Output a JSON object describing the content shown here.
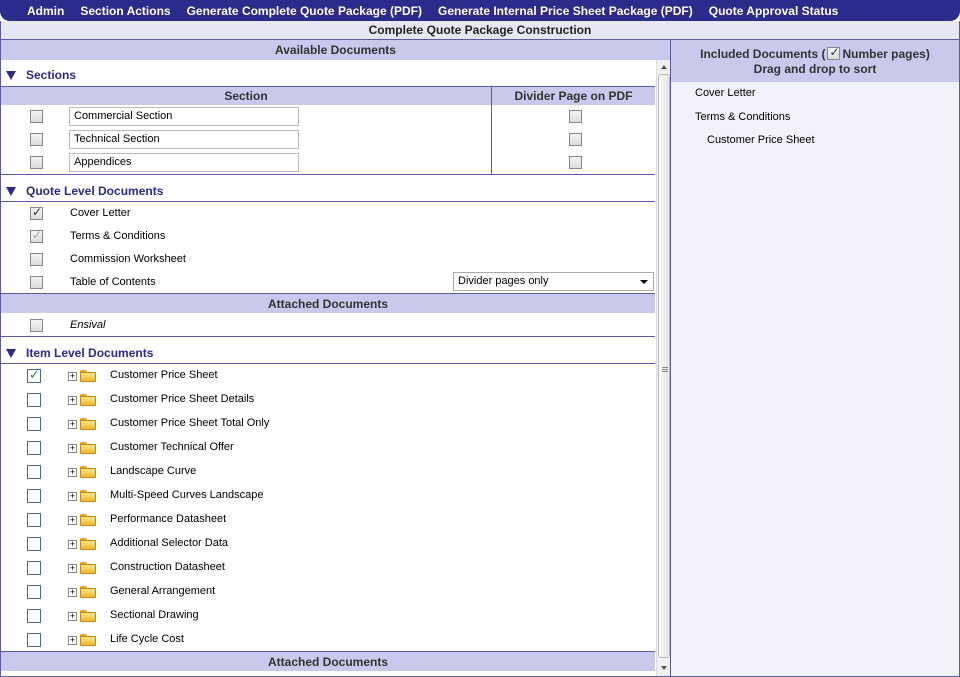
{
  "menu": [
    "Admin",
    "Section Actions",
    "Generate Complete Quote Package (PDF)",
    "Generate Internal Price Sheet Package (PDF)",
    "Quote Approval Status"
  ],
  "title": "Complete Quote Package Construction",
  "available": {
    "header": "Available Documents",
    "sections": {
      "title": "Sections",
      "col_section": "Section",
      "col_divider": "Divider Page on PDF",
      "rows": [
        {
          "name": "Commercial Section",
          "checked": false,
          "divider": false
        },
        {
          "name": "Technical Section",
          "checked": false,
          "divider": false
        },
        {
          "name": "Appendices",
          "checked": false,
          "divider": false
        }
      ]
    },
    "quote_level": {
      "title": "Quote Level Documents",
      "items": [
        {
          "label": "Cover Letter",
          "checked": true,
          "disabled": false
        },
        {
          "label": "Terms & Conditions",
          "checked": true,
          "disabled": true
        },
        {
          "label": "Commission Worksheet",
          "checked": false,
          "disabled": false
        },
        {
          "label": "Table of Contents",
          "checked": false,
          "disabled": false
        }
      ],
      "toc_select": "Divider pages only"
    },
    "attached_header": "Attached Documents",
    "attached": [
      {
        "label": "Ensival",
        "checked": false
      }
    ],
    "item_level": {
      "title": "Item Level Documents",
      "items": [
        {
          "label": "Customer Price Sheet",
          "checked": true
        },
        {
          "label": "Customer Price Sheet Details",
          "checked": false
        },
        {
          "label": "Customer Price Sheet Total Only",
          "checked": false
        },
        {
          "label": "Customer Technical Offer",
          "checked": false
        },
        {
          "label": "Landscape Curve",
          "checked": false
        },
        {
          "label": "Multi-Speed Curves Landscape",
          "checked": false
        },
        {
          "label": "Performance Datasheet",
          "checked": false
        },
        {
          "label": "Additional Selector Data",
          "checked": false
        },
        {
          "label": "Construction Datasheet",
          "checked": false
        },
        {
          "label": "General Arrangement",
          "checked": false
        },
        {
          "label": "Sectional Drawing",
          "checked": false
        },
        {
          "label": "Life Cycle Cost",
          "checked": false
        }
      ]
    },
    "attached_header_2": "Attached Documents"
  },
  "included": {
    "header_pre": "Included Documents (",
    "number_pages_label": "Number pages)",
    "number_pages_checked": true,
    "subheader": "Drag and drop to sort",
    "items": [
      "Cover Letter",
      "Terms & Conditions",
      "Customer Price Sheet"
    ]
  }
}
